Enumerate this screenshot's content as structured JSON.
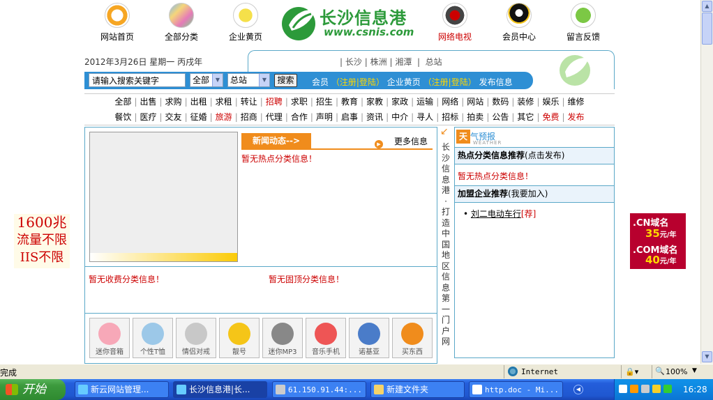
{
  "nav": [
    {
      "label": "网站首页",
      "icon": "refresh-icon"
    },
    {
      "label": "全部分类",
      "icon": "categories-icon"
    },
    {
      "label": "企业黄页",
      "icon": "book-icon"
    },
    {
      "label": "网络电视",
      "icon": "tv-icon"
    },
    {
      "label": "会员中心",
      "icon": "qq-penguin-icon"
    },
    {
      "label": "留言反馈",
      "icon": "message-icon"
    }
  ],
  "logo": {
    "title": "长沙信息港",
    "url_text": "www.csnis.com"
  },
  "date_text": "2012年3月26日 星期一 丙戌年",
  "cities": [
    "长沙",
    "株洲",
    "湘潭",
    "总站"
  ],
  "search": {
    "placeholder": "请输入搜索关键字",
    "scope": "全部",
    "site": "总站",
    "button": "搜索"
  },
  "userlinks": {
    "member": "会员",
    "register": "注册",
    "login": "登陆",
    "company": "企业黄页",
    "register2": "注册",
    "login2": "登陆",
    "publish": "发布信息"
  },
  "categories_row1": [
    "全部",
    "出售",
    "求购",
    "出租",
    "求租",
    "转让",
    "招聘",
    "求职",
    "招生",
    "教育",
    "家教",
    "家政",
    "运输",
    "网络",
    "网站",
    "数码",
    "装修",
    "娱乐",
    "维修"
  ],
  "categories_row2": [
    "餐饮",
    "医疗",
    "交友",
    "征婚",
    "旅游",
    "招商",
    "代理",
    "合作",
    "声明",
    "启事",
    "资讯",
    "中介",
    "寻人",
    "招标",
    "拍卖",
    "公告",
    "其它",
    "免费",
    "发布"
  ],
  "news": {
    "tab": "新闻动态-->",
    "more": "更多信息",
    "empty_hot": "暂无热点分类信息！",
    "empty_paid": "暂无收费分类信息！",
    "empty_fixed": "暂无固顶分类信息！"
  },
  "thumbs": [
    "迷你音箱",
    "个性T恤",
    "情侣对戒",
    "靓号",
    "迷你MP3",
    "音乐手机",
    "诺基亚",
    "买东西"
  ],
  "vertical_text": "长沙信息港·打造中国地区信息第一门户网",
  "weather": {
    "big": "天",
    "rest": "气预报",
    "en": "WEATHER"
  },
  "right": {
    "hot_title": "热点分类信息推荐",
    "hot_note": "(点击发布)",
    "hot_empty": "暂无热点分类信息！",
    "join_title": "加盟企业推荐",
    "join_note": "(我要加入)",
    "join_item": "刘二电动车行",
    "join_tag": "[荐]"
  },
  "ad_left": [
    "1600兆",
    "流量不限",
    "IIS不限"
  ],
  "ad_right": [
    {
      "domain": ".CN域名",
      "price": "35",
      "unit": "元/年"
    },
    {
      "domain": ".COM域名",
      "price": "40",
      "unit": "元/年"
    }
  ],
  "statusbar": {
    "text": "完成",
    "zone": "Internet",
    "zoom": "100%"
  },
  "taskbar": {
    "start": "开始",
    "items": [
      "新云网站管理...",
      "长沙信息港|长...",
      "61.150.91.44:...",
      "新建文件夹",
      "http.doc - Mi..."
    ],
    "clock": "16:28"
  },
  "colors": {
    "accent": "#2e8fd4",
    "orange": "#f08c1c",
    "red": "#cc0000",
    "border": "#5aa8c8"
  }
}
